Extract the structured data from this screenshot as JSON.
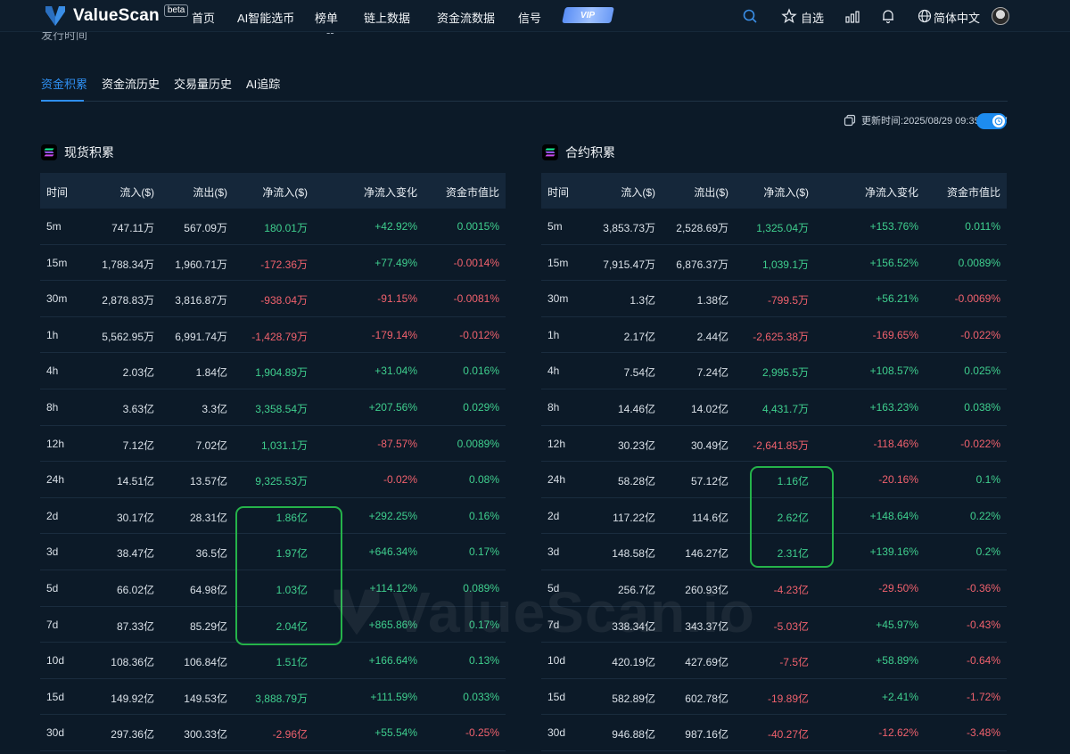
{
  "nav": {
    "brand": "ValueScan",
    "beta": "beta",
    "items": [
      "首页",
      "AI智能选币",
      "榜单",
      "链上数据",
      "资金流数据",
      "信号"
    ],
    "vip": "VIP",
    "watchlist": "自选",
    "language": "简体中文"
  },
  "clipped_row": {
    "label": "发行时间",
    "value": "--"
  },
  "tabs": [
    "资金积累",
    "资金流历史",
    "交易量历史",
    "AI追踪"
  ],
  "active_tab": 0,
  "update_time": "更新时间:2025/08/29 09:35:00",
  "columns": [
    "时间",
    "流入($)",
    "流出($)",
    "净流入($)",
    "净流入变化",
    "资金市值比"
  ],
  "spot": {
    "title": "现货积累",
    "rows": [
      [
        "5m",
        "747.11万",
        "567.09万",
        "180.01万",
        "+42.92%",
        "0.0015%"
      ],
      [
        "15m",
        "1,788.34万",
        "1,960.71万",
        "-172.36万",
        "+77.49%",
        "-0.0014%"
      ],
      [
        "30m",
        "2,878.83万",
        "3,816.87万",
        "-938.04万",
        "-91.15%",
        "-0.0081%"
      ],
      [
        "1h",
        "5,562.95万",
        "6,991.74万",
        "-1,428.79万",
        "-179.14%",
        "-0.012%"
      ],
      [
        "4h",
        "2.03亿",
        "1.84亿",
        "1,904.89万",
        "+31.04%",
        "0.016%"
      ],
      [
        "8h",
        "3.63亿",
        "3.3亿",
        "3,358.54万",
        "+207.56%",
        "0.029%"
      ],
      [
        "12h",
        "7.12亿",
        "7.02亿",
        "1,031.1万",
        "-87.57%",
        "0.0089%"
      ],
      [
        "24h",
        "14.51亿",
        "13.57亿",
        "9,325.53万",
        "-0.02%",
        "0.08%"
      ],
      [
        "2d",
        "30.17亿",
        "28.31亿",
        "1.86亿",
        "+292.25%",
        "0.16%"
      ],
      [
        "3d",
        "38.47亿",
        "36.5亿",
        "1.97亿",
        "+646.34%",
        "0.17%"
      ],
      [
        "5d",
        "66.02亿",
        "64.98亿",
        "1.03亿",
        "+114.12%",
        "0.089%"
      ],
      [
        "7d",
        "87.33亿",
        "85.29亿",
        "2.04亿",
        "+865.86%",
        "0.17%"
      ],
      [
        "10d",
        "108.36亿",
        "106.84亿",
        "1.51亿",
        "+166.64%",
        "0.13%"
      ],
      [
        "15d",
        "149.92亿",
        "149.53亿",
        "3,888.79万",
        "+111.59%",
        "0.033%"
      ],
      [
        "30d",
        "297.36亿",
        "300.33亿",
        "-2.96亿",
        "+55.54%",
        "-0.25%"
      ]
    ]
  },
  "futures": {
    "title": "合约积累",
    "rows": [
      [
        "5m",
        "3,853.73万",
        "2,528.69万",
        "1,325.04万",
        "+153.76%",
        "0.011%"
      ],
      [
        "15m",
        "7,915.47万",
        "6,876.37万",
        "1,039.1万",
        "+156.52%",
        "0.0089%"
      ],
      [
        "30m",
        "1.3亿",
        "1.38亿",
        "-799.5万",
        "+56.21%",
        "-0.0069%"
      ],
      [
        "1h",
        "2.17亿",
        "2.44亿",
        "-2,625.38万",
        "-169.65%",
        "-0.022%"
      ],
      [
        "4h",
        "7.54亿",
        "7.24亿",
        "2,995.5万",
        "+108.57%",
        "0.025%"
      ],
      [
        "8h",
        "14.46亿",
        "14.02亿",
        "4,431.7万",
        "+163.23%",
        "0.038%"
      ],
      [
        "12h",
        "30.23亿",
        "30.49亿",
        "-2,641.85万",
        "-118.46%",
        "-0.022%"
      ],
      [
        "24h",
        "58.28亿",
        "57.12亿",
        "1.16亿",
        "-20.16%",
        "0.1%"
      ],
      [
        "2d",
        "117.22亿",
        "114.6亿",
        "2.62亿",
        "+148.64%",
        "0.22%"
      ],
      [
        "3d",
        "148.58亿",
        "146.27亿",
        "2.31亿",
        "+139.16%",
        "0.2%"
      ],
      [
        "5d",
        "256.7亿",
        "260.93亿",
        "-4.23亿",
        "-29.50%",
        "-0.36%"
      ],
      [
        "7d",
        "338.34亿",
        "343.37亿",
        "-5.03亿",
        "+45.97%",
        "-0.43%"
      ],
      [
        "10d",
        "420.19亿",
        "427.69亿",
        "-7.5亿",
        "+58.89%",
        "-0.64%"
      ],
      [
        "15d",
        "582.89亿",
        "602.78亿",
        "-19.89亿",
        "+2.41%",
        "-1.72%"
      ],
      [
        "30d",
        "946.88亿",
        "987.16亿",
        "-40.27亿",
        "-12.62%",
        "-3.48%"
      ]
    ]
  },
  "colors": {
    "positive": "#3fcf8e",
    "negative": "#f0616d",
    "accent": "#2f8ff1",
    "highlight": "#25b34a"
  },
  "watermark": "ValueScan.io"
}
